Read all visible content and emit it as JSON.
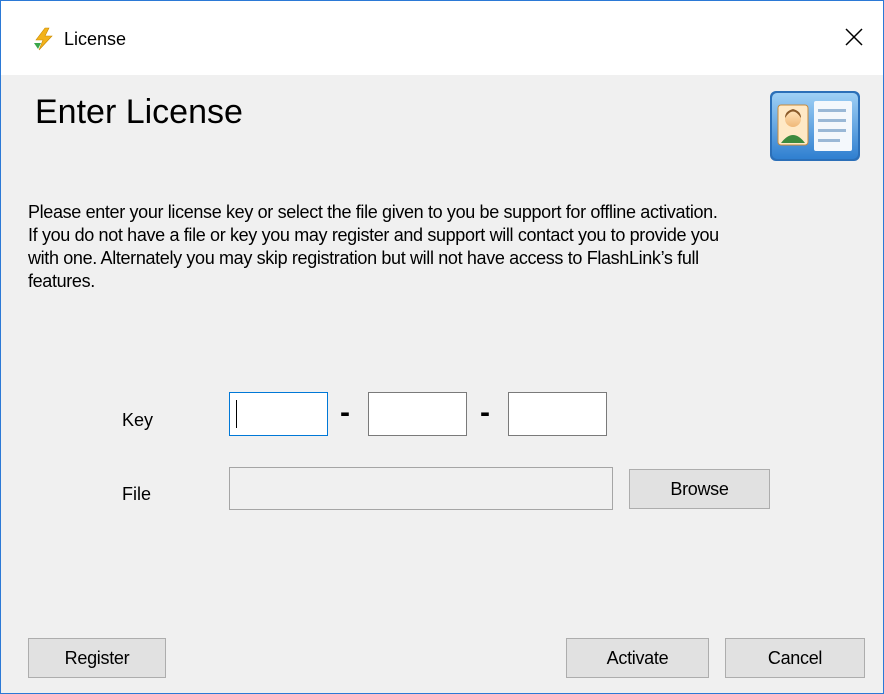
{
  "window": {
    "title": "License",
    "close_symbol": "✕",
    "icons": {
      "app": "lightning-icon",
      "header": "id-card-icon",
      "close": "close-icon"
    }
  },
  "header": {
    "title": "Enter License"
  },
  "description": {
    "lines": [
      "Please enter your license key or select the file given to you be support for offline activation.",
      "If you do not have a file or key you may register and support will contact you to provide you",
      "with one. Alternately you may skip registration but will not have access to FlashLink’s full",
      "features."
    ]
  },
  "form": {
    "key_label": "Key",
    "key_separator": "-",
    "key_parts": [
      "",
      "",
      ""
    ],
    "file_label": "File",
    "file_value": "",
    "browse_label": "Browse"
  },
  "footer": {
    "register_label": "Register",
    "activate_label": "Activate",
    "cancel_label": "Cancel"
  },
  "colors": {
    "window_border": "#2b79d6",
    "focus_border": "#0078d7",
    "button_face": "#e1e1e1",
    "dialog_background": "#f0f0f0"
  }
}
